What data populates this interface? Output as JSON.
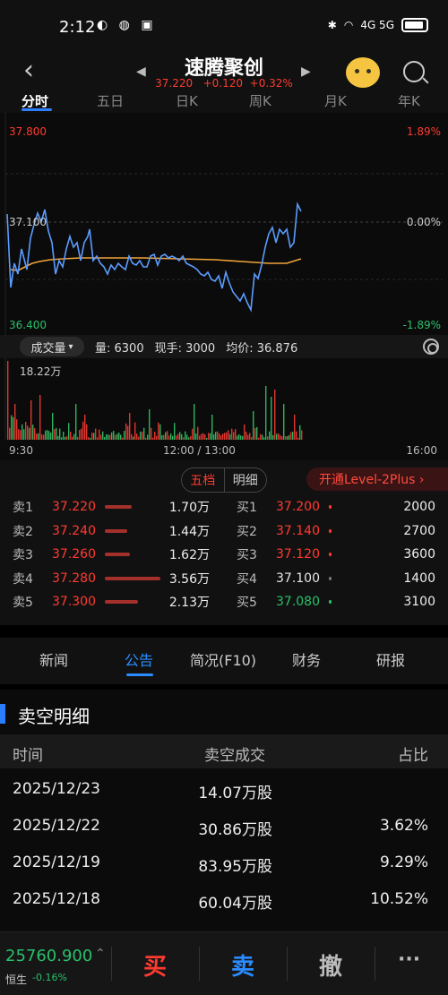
{
  "status": {
    "time": "2:12",
    "left_icons": "◐ ◍ ▣",
    "signal_text": "4G 5G"
  },
  "header": {
    "title": "速腾聚创",
    "price": "37.220",
    "change": "+0.120",
    "change_pct": "+0.32%",
    "back_icon": "‹",
    "prev_icon": "◀",
    "next_icon": "▶"
  },
  "period_tabs": [
    "分时",
    "五日",
    "日K",
    "周K",
    "月K",
    "年K"
  ],
  "chart": {
    "y_high": "37.800",
    "y_mid": "37.100",
    "y_low": "36.400",
    "pct_high": "1.89%",
    "pct_mid": "0.00%",
    "pct_low": "-1.89%",
    "price_color": "#5b9cff",
    "avg_color": "#f0a33a"
  },
  "volume_bar": {
    "select_label": "成交量",
    "vol": "量: 6300",
    "current_hand": "现手: 3000",
    "avg_price": "均价: 36.876",
    "max_label": "18.22万"
  },
  "time_axis": {
    "start": "9:30",
    "middle": "12:00 / 13:00",
    "end": "16:00"
  },
  "orderbook": {
    "tab_active": "五档",
    "tab_inactive": "明细",
    "level2_label": "开通Level-2Plus ›",
    "asks": [
      {
        "label": "卖1",
        "price": "37.220",
        "qty": "1.70万",
        "fill": 0.48
      },
      {
        "label": "卖2",
        "price": "37.240",
        "qty": "1.44万",
        "fill": 0.4
      },
      {
        "label": "卖3",
        "price": "37.260",
        "qty": "1.62万",
        "fill": 0.45
      },
      {
        "label": "卖4",
        "price": "37.280",
        "qty": "3.56万",
        "fill": 1.0
      },
      {
        "label": "卖5",
        "price": "37.300",
        "qty": "2.13万",
        "fill": 0.6
      }
    ],
    "bids": [
      {
        "label": "买1",
        "price": "37.200",
        "qty": "2000",
        "color": "#ff3b30"
      },
      {
        "label": "买2",
        "price": "37.140",
        "qty": "2700",
        "color": "#ff3b30"
      },
      {
        "label": "买3",
        "price": "37.120",
        "qty": "3600",
        "color": "#ff3b30"
      },
      {
        "label": "买4",
        "price": "37.100",
        "qty": "1400",
        "color": "#e6e6e6"
      },
      {
        "label": "买5",
        "price": "37.080",
        "qty": "3100",
        "color": "#29c06b"
      }
    ]
  },
  "news_tabs": [
    "新闻",
    "公告",
    "简况(F10)",
    "财务",
    "研报"
  ],
  "short_sell": {
    "title": "卖空明细",
    "headers": [
      "时间",
      "卖空成交",
      "占比"
    ],
    "rows": [
      {
        "date": "2025/12/23",
        "volume": "14.07万股",
        "ratio": ""
      },
      {
        "date": "2025/12/22",
        "volume": "30.86万股",
        "ratio": "3.62%"
      },
      {
        "date": "2025/12/19",
        "volume": "83.95万股",
        "ratio": "9.29%"
      },
      {
        "date": "2025/12/18",
        "volume": "60.04万股",
        "ratio": "10.52%"
      }
    ]
  },
  "bottom": {
    "index_value": "25760.900",
    "index_arrow": "⌃",
    "index_name": "恒生",
    "index_change": "-0.16%",
    "buy": "买",
    "sell": "卖",
    "cancel": "撤",
    "more": "···"
  }
}
